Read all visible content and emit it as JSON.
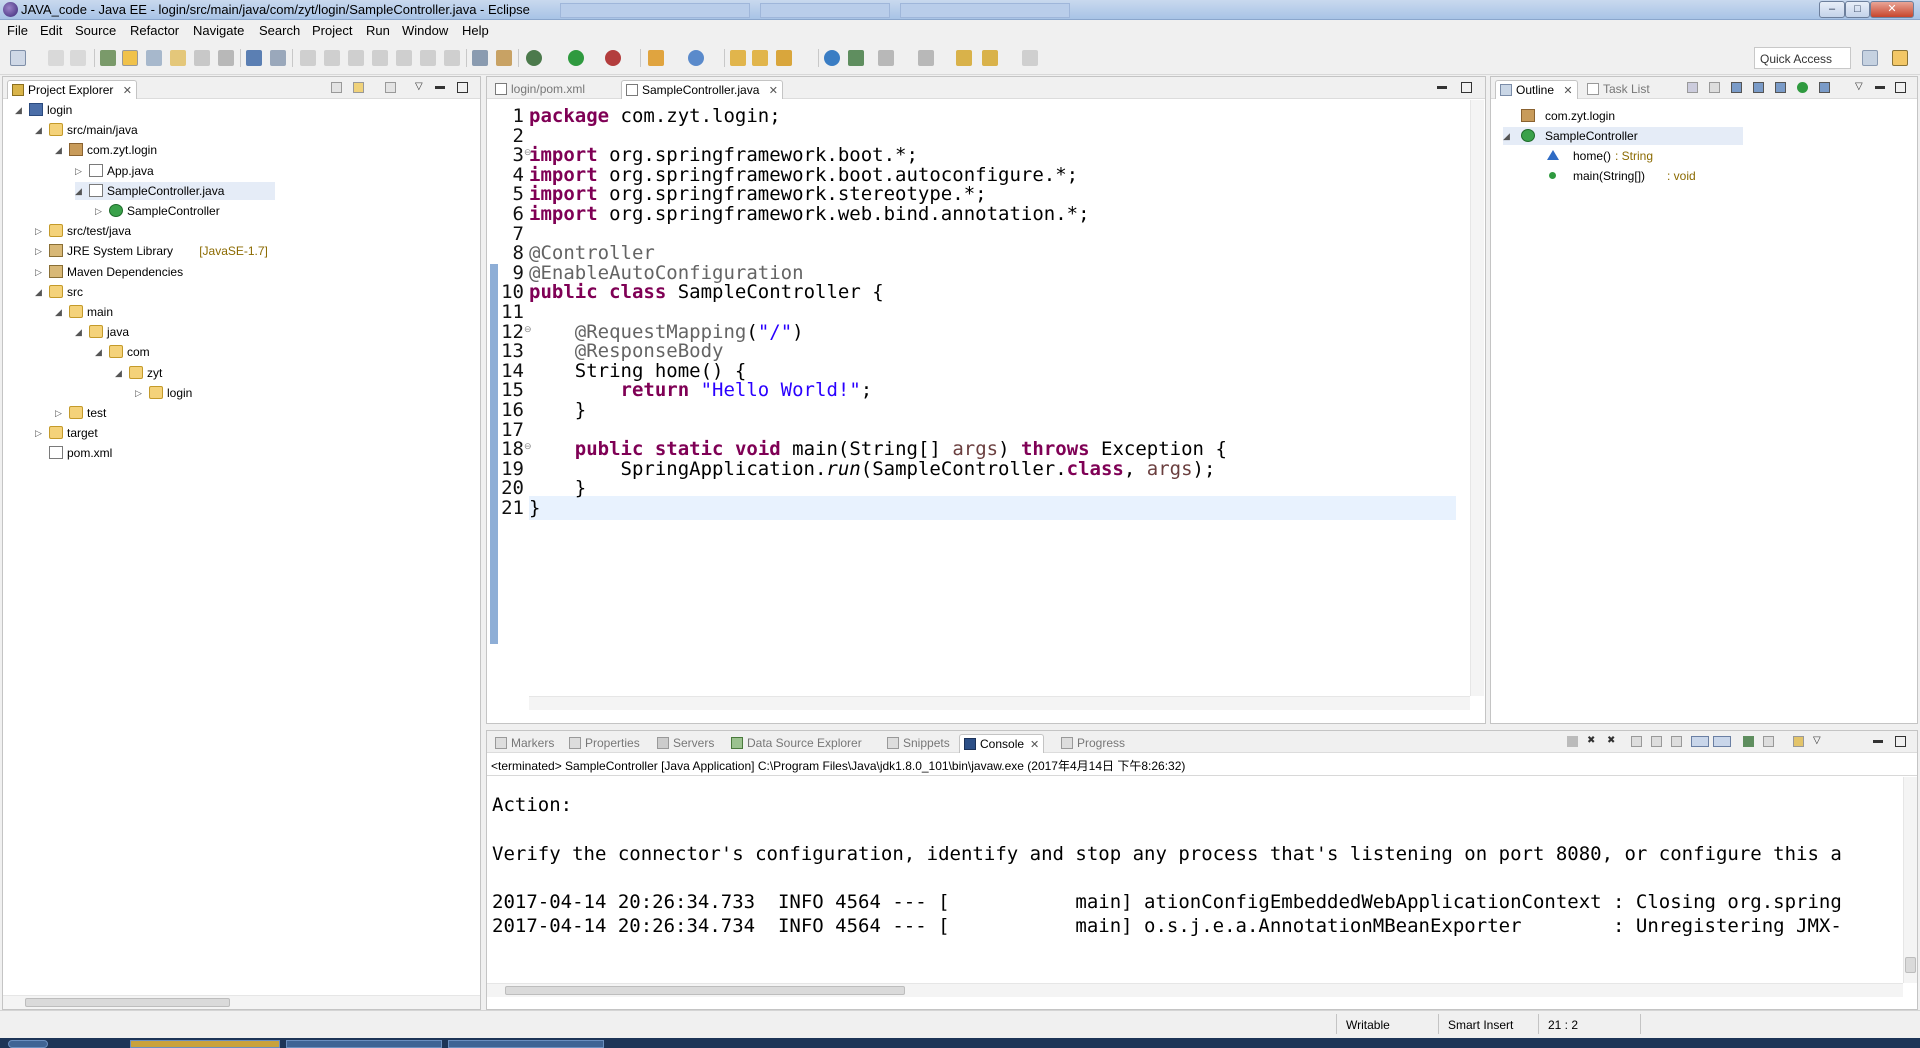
{
  "window": {
    "title": "JAVA_code - Java EE - login/src/main/java/com/zyt/login/SampleController.java - Eclipse",
    "buttons": {
      "minimize": "–",
      "maximize": "□",
      "close": "✕"
    }
  },
  "menu": [
    "File",
    "Edit",
    "Source",
    "Refactor",
    "Navigate",
    "Search",
    "Project",
    "Run",
    "Window",
    "Help"
  ],
  "toolbar": {
    "quick_access": "Quick Access"
  },
  "project_explorer": {
    "title": "Project Explorer",
    "close": "✕",
    "tree": [
      {
        "label": "login",
        "icon": "project",
        "arrow": "◢",
        "decoration": ""
      },
      {
        "label": "src/main/java",
        "icon": "package-folder",
        "arrow": "◢",
        "decoration": ""
      },
      {
        "label": "com.zyt.login",
        "icon": "package",
        "arrow": "◢",
        "decoration": ""
      },
      {
        "label": "App.java",
        "icon": "java-file",
        "arrow": "▷",
        "decoration": ""
      },
      {
        "label": "SampleController.java",
        "icon": "java-file",
        "arrow": "◢",
        "decoration": ""
      },
      {
        "label": "SampleController",
        "icon": "class",
        "arrow": "▷",
        "decoration": ""
      },
      {
        "label": "src/test/java",
        "icon": "package-folder",
        "arrow": "▷",
        "decoration": ""
      },
      {
        "label": "JRE System Library",
        "icon": "library",
        "arrow": "▷",
        "decoration": "[JavaSE-1.7]"
      },
      {
        "label": "Maven Dependencies",
        "icon": "library",
        "arrow": "▷",
        "decoration": ""
      },
      {
        "label": "src",
        "icon": "folder",
        "arrow": "◢",
        "decoration": ""
      },
      {
        "label": "main",
        "icon": "folder",
        "arrow": "◢",
        "decoration": ""
      },
      {
        "label": "java",
        "icon": "folder",
        "arrow": "◢",
        "decoration": ""
      },
      {
        "label": "com",
        "icon": "folder",
        "arrow": "◢",
        "decoration": ""
      },
      {
        "label": "zyt",
        "icon": "folder",
        "arrow": "◢",
        "decoration": ""
      },
      {
        "label": "login",
        "icon": "folder",
        "arrow": "▷",
        "decoration": ""
      },
      {
        "label": "test",
        "icon": "folder",
        "arrow": "▷",
        "decoration": ""
      },
      {
        "label": "target",
        "icon": "folder",
        "arrow": "▷",
        "decoration": ""
      },
      {
        "label": "pom.xml",
        "icon": "xml-file",
        "arrow": "",
        "decoration": ""
      }
    ]
  },
  "editor": {
    "tabs": [
      {
        "label": "login/pom.xml",
        "active": false
      },
      {
        "label": "SampleController.java",
        "active": true
      }
    ],
    "close": "✕",
    "fold_marker": "⊖",
    "lines": [
      "package com.zyt.login;",
      "",
      "import org.springframework.boot.*;",
      "import org.springframework.boot.autoconfigure.*;",
      "import org.springframework.stereotype.*;",
      "import org.springframework.web.bind.annotation.*;",
      "",
      "@Controller",
      "@EnableAutoConfiguration",
      "public class SampleController {",
      "",
      "    @RequestMapping(\"/\")",
      "    @ResponseBody",
      "    String home() {",
      "        return \"Hello World!\";",
      "    }",
      "",
      "    public static void main(String[] args) throws Exception {",
      "        SpringApplication.run(SampleController.class, args);",
      "    }",
      "}"
    ]
  },
  "outline": {
    "tabs": [
      {
        "label": "Outline",
        "active": true
      },
      {
        "label": "Task List",
        "active": false
      }
    ],
    "close": "✕",
    "items": [
      {
        "label": "com.zyt.login",
        "type": "",
        "icon": "package"
      },
      {
        "label": "SampleController",
        "type": "",
        "icon": "class"
      },
      {
        "label": "home()",
        "type": " : String",
        "icon": "method-default"
      },
      {
        "label": "main(String[])",
        "type": " : void",
        "icon": "method-public-static"
      }
    ]
  },
  "bottom_panel": {
    "tabs": [
      {
        "label": "Markers",
        "active": false
      },
      {
        "label": "Properties",
        "active": false
      },
      {
        "label": "Servers",
        "active": false
      },
      {
        "label": "Data Source Explorer",
        "active": false
      },
      {
        "label": "Snippets",
        "active": false
      },
      {
        "label": "Console",
        "active": true
      },
      {
        "label": "Progress",
        "active": false
      }
    ],
    "close": "✕",
    "console_header": "<terminated> SampleController [Java Application] C:\\Program Files\\Java\\jdk1.8.0_101\\bin\\javaw.exe (2017年4月14日 下午8:26:32)",
    "console_lines": [
      "",
      "Action:",
      "",
      "Verify the connector's configuration, identify and stop any process that's listening on port 8080, or configure this a",
      "",
      "2017-04-14 20:26:34.733  INFO 4564 --- [           main] ationConfigEmbeddedWebApplicationContext : Closing org.spring",
      "2017-04-14 20:26:34.734  INFO 4564 --- [           main] o.s.j.e.a.AnnotationMBeanExporter        : Unregistering JMX-"
    ]
  },
  "status": {
    "writable": "Writable",
    "insert_mode": "Smart Insert",
    "position": "21 : 2"
  }
}
